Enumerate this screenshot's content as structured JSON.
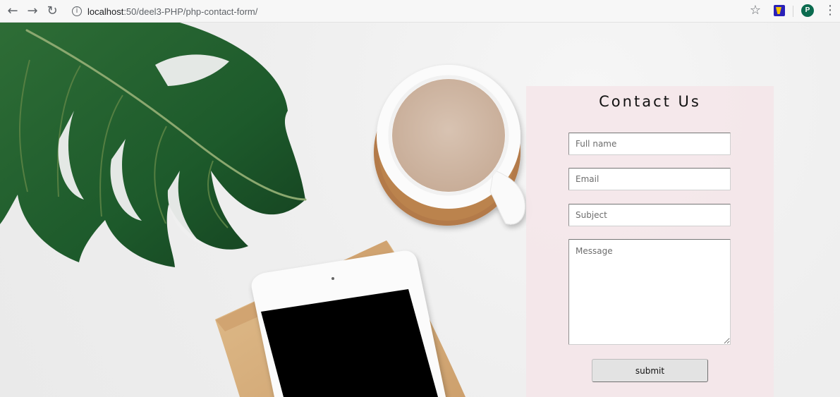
{
  "browser": {
    "back_icon": "back-arrow-icon",
    "forward_icon": "forward-arrow-icon",
    "reload_icon": "reload-icon",
    "info_icon": "info-icon",
    "url_host": "localhost",
    "url_rest": ":50/deel3-PHP/php-contact-form/",
    "bookmark_icon": "star-icon",
    "extension_icon": "extension-icon",
    "profile_initial": "P",
    "menu_icon": "more-vert-icon",
    "colors": {
      "toolbar_background": "#f7f7f7",
      "avatar": "#0b6b4f",
      "extension_background": "#2a21b8",
      "extension_accent": "#f8c400"
    }
  },
  "contact": {
    "title": "Contact Us",
    "full_name_placeholder": "Full name",
    "email_placeholder": "Email",
    "subject_placeholder": "Subject",
    "message_placeholder": "Message",
    "submit_label": "submit",
    "colors": {
      "panel_background": "#f4e5e9",
      "input_background": "#ffffff",
      "button_background": "#e3e3e3",
      "title_text": "#111111"
    }
  },
  "hero": {
    "items": [
      "monstera-leaf",
      "coffee-cup",
      "cork-coaster",
      "tablet",
      "wooden-board"
    ],
    "colors": {
      "background": "#efefef",
      "leaf": "#1f5b2c",
      "coffee": "#cdb6a2",
      "cup": "#fbfbfb",
      "cork": "#b37a48",
      "board": "#d8b07a",
      "tablet_screen": "#000000"
    }
  }
}
